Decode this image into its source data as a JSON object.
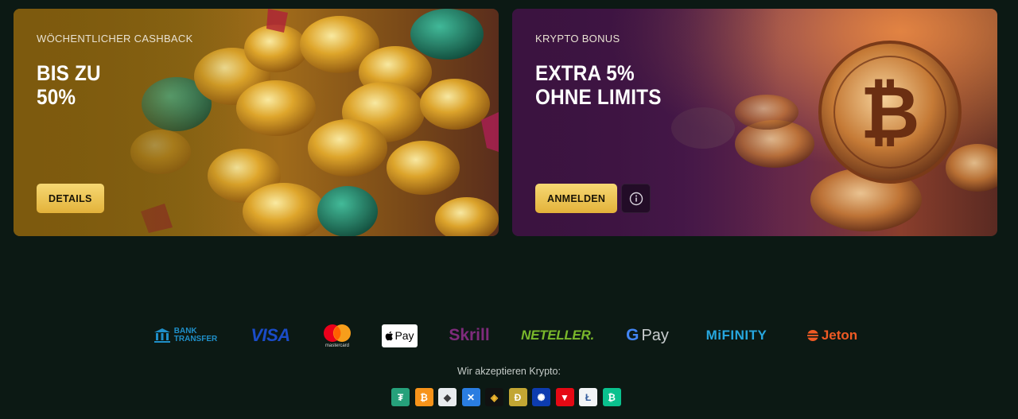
{
  "promos": [
    {
      "label": "WÖCHENTLICHER CASHBACK",
      "title": "BIS ZU\n50%",
      "button": "DETAILS"
    },
    {
      "label": "KRYPTO BONUS",
      "title": "EXTRA 5%\nOHNE LIMITS",
      "button": "ANMELDEN",
      "info_icon": "info-icon"
    }
  ],
  "payments": {
    "bank_transfer": {
      "line1": "BANK",
      "line2": "TRANSFER"
    },
    "visa": "VISA",
    "mastercard": "mastercard",
    "apple_pay": "Pay",
    "skrill": "Skrill",
    "neteller": "NETELLER.",
    "google_pay": {
      "g": "G",
      "pay": "Pay"
    },
    "mifinity": "MiFINITY",
    "jeton": "Jeton"
  },
  "crypto": {
    "caption": "Wir akzeptieren Krypto:",
    "icons": [
      {
        "name": "tether-icon",
        "glyph": "₮",
        "bg": "#26a17b",
        "fg": "#ffffff"
      },
      {
        "name": "bitcoin-icon",
        "glyph": "₿",
        "bg": "#f7931a",
        "fg": "#ffffff"
      },
      {
        "name": "ethereum-icon",
        "glyph": "◆",
        "bg": "#e9ecef",
        "fg": "#3c3c3d"
      },
      {
        "name": "ripple-icon",
        "glyph": "✕",
        "bg": "#2a7de1",
        "fg": "#ffffff"
      },
      {
        "name": "binance-icon",
        "glyph": "◈",
        "bg": "#111111",
        "fg": "#f3ba2f"
      },
      {
        "name": "dogecoin-icon",
        "glyph": "Ð",
        "bg": "#c2a633",
        "fg": "#ffffff"
      },
      {
        "name": "cardano-icon",
        "glyph": "✺",
        "bg": "#0d3cb0",
        "fg": "#ffffff"
      },
      {
        "name": "tron-icon",
        "glyph": "▼",
        "bg": "#e50914",
        "fg": "#ffffff"
      },
      {
        "name": "litecoin-icon",
        "glyph": "Ł",
        "bg": "#f2f4f6",
        "fg": "#345d9d"
      },
      {
        "name": "bitcoin-cash-icon",
        "glyph": "₿",
        "bg": "#0ac18e",
        "fg": "#ffffff"
      }
    ]
  },
  "colors": {
    "page_bg": "#0c1914",
    "gold_button": "#eec55a",
    "bank_transfer": "#1f8fc9",
    "visa": "#1a4cc8",
    "skrill": "#7f2b7c",
    "neteller": "#7ab82b",
    "mifinity": "#27a7df",
    "jeton": "#ef5a24"
  }
}
